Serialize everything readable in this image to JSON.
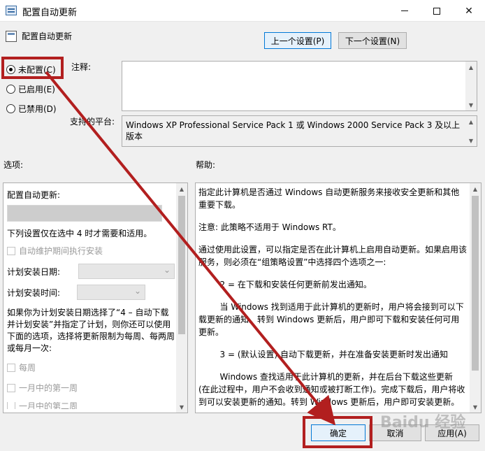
{
  "window": {
    "title": "配置自动更新"
  },
  "header": {
    "title": "配置自动更新",
    "prev_label": "上一个设置(P)",
    "next_label": "下一个设置(N)"
  },
  "state": {
    "options": [
      {
        "label": "未配置(C)",
        "checked": true
      },
      {
        "label": "已启用(E)",
        "checked": false
      },
      {
        "label": "已禁用(D)",
        "checked": false
      }
    ]
  },
  "comment": {
    "label": "注释:",
    "value": ""
  },
  "platform": {
    "label": "支持的平台:",
    "value": "Windows XP Professional Service Pack 1 或 Windows 2000 Service Pack 3 及以上版本"
  },
  "options_panel": {
    "label": "选项:",
    "title": "配置自动更新:",
    "note": "下列设置仅在选中 4 时才需要和适用。",
    "maintenance_checkbox": "自动维护期间执行安装",
    "schedule_day_label": "计划安装日期:",
    "schedule_time_label": "计划安装时间:",
    "para": "如果你为计划安装日期选择了“4 – 自动下载并计划安装”并指定了计划，则你还可以使用下面的选项，选择将更新限制为每周、每两周或每月一次:",
    "weekly_checkbox": "每周",
    "first_week_checkbox": "一月中的第一周",
    "second_week_checkbox": "一月中的第二周"
  },
  "help_panel": {
    "label": "帮助:",
    "paragraphs": [
      "指定此计算机是否通过 Windows 自动更新服务来接收安全更新和其他重要下载。",
      "注意: 此策略不适用于 Windows RT。",
      "通过使用此设置，可以指定是否在此计算机上启用自动更新。如果启用该服务，则必须在“组策略设置”中选择四个选项之一:",
      "        2 = 在下载和安装任何更新前发出通知。",
      "        当 Windows 找到适用于此计算机的更新时，用户将会接到可以下载更新的通知。转到 Windows 更新后，用户即可下载和安装任何可用更新。",
      "        3 = (默认设置) 自动下载更新，并在准备安装更新时发出通知",
      "        Windows 查找适用于此计算机的更新，并在后台下载这些更新 (在此过程中，用户不会收到通知或被打断工作)。完成下载后，用户将收到可以安装更新的通知。转到 Windows 更新后，用户即可安装更新。"
    ]
  },
  "footer": {
    "ok_label": "确定",
    "cancel_label": "取消",
    "apply_label": "应用(A)"
  },
  "watermark": "Baidu 经验",
  "colors": {
    "highlight": "#b21f1f",
    "arrow": "#b21f1f",
    "dialog_bg": "#f0f0f0"
  }
}
